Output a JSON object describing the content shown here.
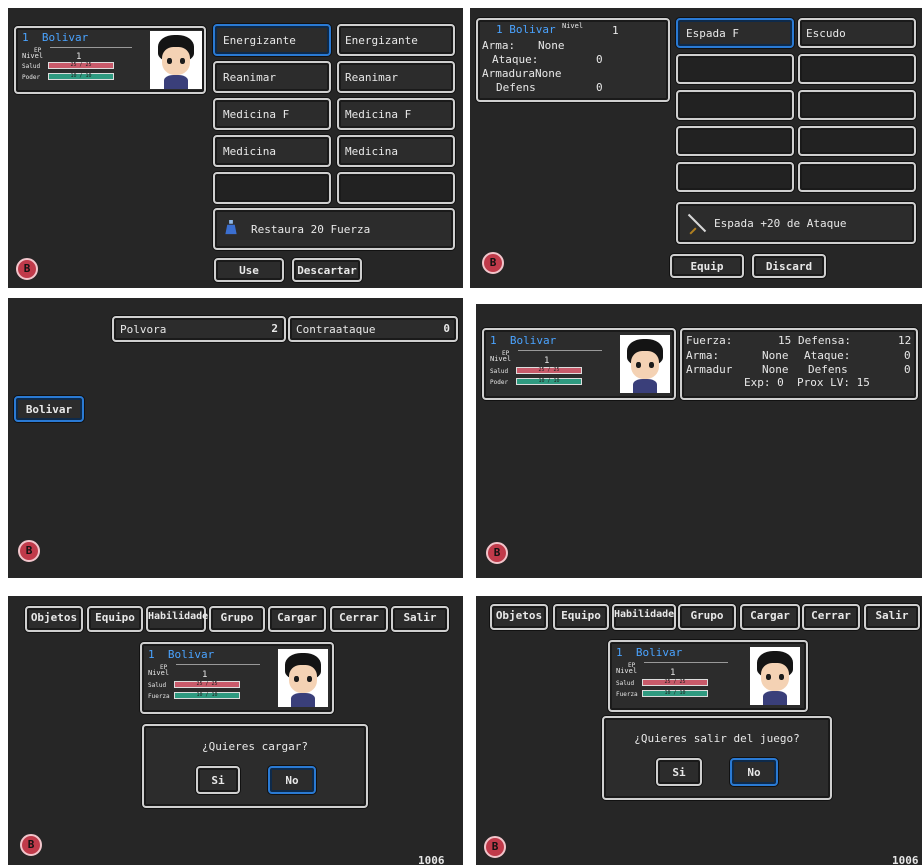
{
  "badge_icon": "B",
  "level_small_label": "Nivel",
  "xp_small_label": "EP",
  "hero": {
    "name_prefix": "1",
    "name": "Bolivar",
    "level": "1",
    "hp_label": "Salud",
    "hp": "25 / 25",
    "mp_label_power": "Poder",
    "mp_label_strength": "Fuerza",
    "mp": "10 / 10",
    "hp_fraction": 1.0,
    "mp_fraction": 1.0
  },
  "screen1": {
    "items": [
      [
        "Energizante",
        "Energizante"
      ],
      [
        "Reanimar",
        "Reanimar"
      ],
      [
        "Medicina F",
        "Medicina F"
      ],
      [
        "Medicina",
        "Medicina"
      ]
    ],
    "description": "Restaura 20 Fuerza",
    "use_button": "Use",
    "discard_button": "Descartar"
  },
  "screen2": {
    "name_label": "1 Bolivar",
    "level_label": "Nivel",
    "level": "1",
    "arma_label": "Arma:",
    "arma_value": "None",
    "ataque_label": "Ataque:",
    "ataque_value": "0",
    "armadura_label": "ArmaduraNone",
    "defens_label": "Defens",
    "defens_value": "0",
    "slot_left": "Espada F",
    "slot_right": "Escudo",
    "description": "Espada +20 de Ataque",
    "equip_button": "Equip",
    "discard_button": "Discard"
  },
  "screen3": {
    "skill1_name": "Polvora",
    "skill1_value": "2",
    "skill2_name": "Contraataque",
    "skill2_value": "0",
    "member_button": "Bolivar"
  },
  "screen4": {
    "fuerza_label": "Fuerza:",
    "fuerza_value": "15",
    "defensa_label": "Defensa:",
    "defensa_value": "12",
    "arma_label": "Arma:",
    "arma_value": "None",
    "ataque_label": "Ataque:",
    "ataque_value": "0",
    "armadur_label": "Armadur",
    "armadur_value": "None",
    "defens_label": "Defens",
    "defens_value": "0",
    "exp_line": "Exp: 0  Prox LV: 15"
  },
  "menu_tabs": [
    "Objetos",
    "Equipo",
    "Habilidade",
    "Grupo",
    "Cargar",
    "Cerrar",
    "Salir"
  ],
  "screen5": {
    "question": "¿Quieres cargar?",
    "yes": "Si",
    "no": "No",
    "counter": "1006"
  },
  "screen6": {
    "question": "¿Quieres salir del juego?",
    "yes": "Si",
    "no": "No",
    "counter": "1006"
  }
}
